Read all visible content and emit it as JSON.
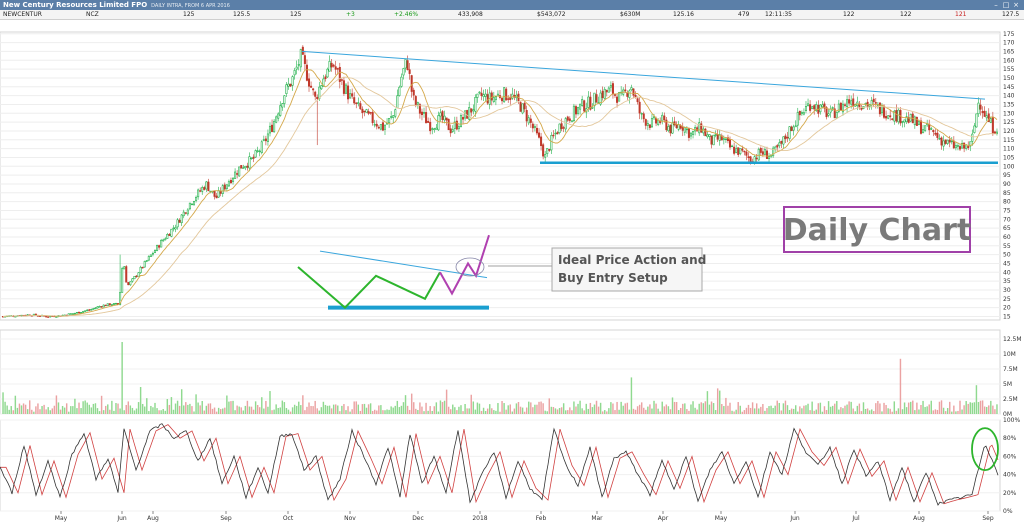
{
  "window": {
    "title": "New Century Resources Limited FPO",
    "subtitle": "DAILY INTRA, FROM 6 APR 2016",
    "buttons": [
      "–",
      "□",
      "×"
    ]
  },
  "quote_bar": {
    "name": "NEWCENTUR",
    "code": "NCZ",
    "bid": "125",
    "ask": "125.5",
    "last": "125",
    "change": "+3",
    "change_pct": "+2.46%",
    "volume": "433,908",
    "value": "$543,072",
    "market_cap": "$630M",
    "vwap": "125.16",
    "trades": "479",
    "time": "12:11:35",
    "open": "122",
    "high": "122",
    "low": "121",
    "close_label": "127.5"
  },
  "colors": {
    "up": "#22b14c",
    "down": "#c0392b",
    "sma_fast": "#d4a84a",
    "sma_slow": "#e3c79b",
    "trendline": "#3aa6dd",
    "support": "#1a9fd0",
    "ideal_up": "#2db52d",
    "ideal_breakout": "#b040b0",
    "label_border": "#a040a8",
    "stoch_k": "#333333",
    "stoch_d": "#d04040",
    "vol_up": "#8fd98f",
    "vol_down": "#eba2a2"
  },
  "annotations": {
    "big_label": "Daily Chart",
    "callout_line1": "Ideal Price Action and",
    "callout_line2": "Buy Entry Setup"
  },
  "chart_data": [
    {
      "type": "candlestick",
      "panel": "price",
      "y_ticks": [
        "175",
        "170",
        "165",
        "160",
        "155",
        "150",
        "145",
        "140",
        "135",
        "130",
        "125",
        "120",
        "115",
        "110",
        "105",
        "100",
        "95",
        "90",
        "85",
        "80",
        "75",
        "70",
        "65",
        "60",
        "55",
        "50",
        "45",
        "40",
        "35",
        "30",
        "25",
        "20",
        "15"
      ],
      "ylim": [
        13,
        176
      ],
      "x_ticks": [
        "May",
        "Jun",
        "Aug",
        "Sep",
        "Oct",
        "Nov",
        "Dec",
        "2018",
        "Feb",
        "Mar",
        "Apr",
        "May",
        "Jun",
        "Jul",
        "Aug",
        "Sep"
      ],
      "x_tick_index": [
        61,
        122,
        153,
        226,
        288,
        350,
        418,
        480,
        541,
        597,
        663,
        721,
        795,
        856,
        919,
        988
      ],
      "n_days": 485,
      "price_path": [
        [
          0,
          15
        ],
        [
          15,
          15.5
        ],
        [
          30,
          16
        ],
        [
          45,
          15
        ],
        [
          60,
          15.5
        ],
        [
          75,
          17
        ],
        [
          90,
          19
        ],
        [
          100,
          21
        ],
        [
          110,
          22
        ],
        [
          118,
          22
        ],
        [
          122,
          48
        ],
        [
          126,
          32
        ],
        [
          132,
          36
        ],
        [
          145,
          46
        ],
        [
          160,
          57
        ],
        [
          175,
          67
        ],
        [
          190,
          80
        ],
        [
          205,
          90
        ],
        [
          215,
          82
        ],
        [
          228,
          92
        ],
        [
          240,
          100
        ],
        [
          252,
          104
        ],
        [
          262,
          112
        ],
        [
          272,
          124
        ],
        [
          282,
          140
        ],
        [
          292,
          150
        ],
        [
          300,
          162
        ],
        [
          306,
          152
        ],
        [
          314,
          138
        ],
        [
          322,
          150
        ],
        [
          332,
          158
        ],
        [
          342,
          146
        ],
        [
          352,
          136
        ],
        [
          362,
          130
        ],
        [
          372,
          126
        ],
        [
          382,
          122
        ],
        [
          392,
          128
        ],
        [
          400,
          150
        ],
        [
          406,
          160
        ],
        [
          412,
          138
        ],
        [
          420,
          130
        ],
        [
          430,
          123
        ],
        [
          440,
          127
        ],
        [
          450,
          121
        ],
        [
          460,
          126
        ],
        [
          470,
          132
        ],
        [
          480,
          140
        ],
        [
          490,
          138
        ],
        [
          500,
          141
        ],
        [
          510,
          140
        ],
        [
          520,
          134
        ],
        [
          530,
          124
        ],
        [
          540,
          112
        ],
        [
          544,
          105
        ],
        [
          550,
          114
        ],
        [
          560,
          124
        ],
        [
          570,
          129
        ],
        [
          580,
          134
        ],
        [
          590,
          136
        ],
        [
          600,
          141
        ],
        [
          610,
          143
        ],
        [
          620,
          138
        ],
        [
          630,
          146
        ],
        [
          640,
          128
        ],
        [
          650,
          124
        ],
        [
          660,
          126
        ],
        [
          670,
          121
        ],
        [
          680,
          124
        ],
        [
          690,
          118
        ],
        [
          700,
          122
        ],
        [
          710,
          114
        ],
        [
          720,
          116
        ],
        [
          730,
          110
        ],
        [
          740,
          108
        ],
        [
          750,
          104
        ],
        [
          760,
          108
        ],
        [
          770,
          106
        ],
        [
          780,
          112
        ],
        [
          790,
          122
        ],
        [
          800,
          130
        ],
        [
          810,
          136
        ],
        [
          820,
          132
        ],
        [
          830,
          129
        ],
        [
          840,
          134
        ],
        [
          850,
          138
        ],
        [
          860,
          136
        ],
        [
          870,
          135
        ],
        [
          880,
          132
        ],
        [
          890,
          130
        ],
        [
          900,
          128
        ],
        [
          910,
          126
        ],
        [
          920,
          122
        ],
        [
          930,
          120
        ],
        [
          940,
          115
        ],
        [
          950,
          112
        ],
        [
          960,
          110
        ],
        [
          970,
          112
        ],
        [
          978,
          138
        ],
        [
          985,
          128
        ],
        [
          992,
          122
        ]
      ],
      "spikes": [
        [
          120,
          50
        ],
        [
          300,
          165
        ],
        [
          316,
          112
        ],
        [
          406,
          159
        ],
        [
          544,
          102
        ],
        [
          978,
          139
        ]
      ],
      "trendline": [
        [
          302,
          165
        ],
        [
          985,
          138
        ]
      ],
      "support_line": [
        [
          540,
          102
        ],
        [
          998,
          102
        ]
      ],
      "ideal_pattern": {
        "uptrend_points": [
          [
            298,
            43
          ],
          [
            345,
            20
          ],
          [
            376,
            38
          ],
          [
            425,
            25
          ],
          [
            440,
            40
          ]
        ],
        "breakout_points": [
          [
            440,
            40
          ],
          [
            452,
            28
          ],
          [
            468,
            45
          ],
          [
            476,
            38
          ],
          [
            489,
            61
          ]
        ],
        "downtrend_line": [
          [
            320,
            52
          ],
          [
            487,
            37
          ]
        ],
        "support_line": [
          [
            328,
            20
          ],
          [
            489,
            20
          ]
        ],
        "circle_center": [
          470,
          43
        ]
      },
      "series": [
        {
          "name": "",
          "kind": "sma_fast"
        },
        {
          "name": "",
          "kind": "sma_slow"
        }
      ]
    },
    {
      "type": "bar",
      "panel": "volume",
      "y_ticks": [
        "12.5M",
        "10M",
        "7.5M",
        "5M",
        "2.5M",
        "0M"
      ],
      "ylim": [
        0,
        14
      ],
      "spikes": [
        [
          122,
          12
        ],
        [
          140,
          4.5
        ],
        [
          260,
          2.8
        ],
        [
          410,
          3.4
        ],
        [
          630,
          6.1
        ],
        [
          900,
          9.2
        ],
        [
          975,
          4.8
        ]
      ],
      "base_level": 1.2
    },
    {
      "type": "line",
      "panel": "stochastic",
      "y_ticks": [
        "100%",
        "80%",
        "60%",
        "40%",
        "20%",
        "0%"
      ],
      "ylim": [
        0,
        100
      ],
      "k_points": [
        [
          0,
          48
        ],
        [
          12,
          20
        ],
        [
          24,
          72
        ],
        [
          36,
          18
        ],
        [
          48,
          55
        ],
        [
          60,
          15
        ],
        [
          72,
          62
        ],
        [
          84,
          86
        ],
        [
          96,
          35
        ],
        [
          108,
          58
        ],
        [
          118,
          20
        ],
        [
          124,
          90
        ],
        [
          136,
          45
        ],
        [
          150,
          88
        ],
        [
          162,
          95
        ],
        [
          174,
          80
        ],
        [
          186,
          88
        ],
        [
          198,
          55
        ],
        [
          210,
          80
        ],
        [
          222,
          30
        ],
        [
          234,
          60
        ],
        [
          246,
          15
        ],
        [
          258,
          48
        ],
        [
          268,
          20
        ],
        [
          280,
          82
        ],
        [
          292,
          85
        ],
        [
          304,
          45
        ],
        [
          316,
          60
        ],
        [
          328,
          12
        ],
        [
          340,
          35
        ],
        [
          352,
          88
        ],
        [
          364,
          60
        ],
        [
          376,
          30
        ],
        [
          388,
          70
        ],
        [
          400,
          15
        ],
        [
          410,
          85
        ],
        [
          422,
          30
        ],
        [
          434,
          60
        ],
        [
          446,
          20
        ],
        [
          458,
          90
        ],
        [
          470,
          10
        ],
        [
          482,
          40
        ],
        [
          494,
          65
        ],
        [
          506,
          15
        ],
        [
          518,
          55
        ],
        [
          530,
          25
        ],
        [
          542,
          12
        ],
        [
          554,
          90
        ],
        [
          566,
          50
        ],
        [
          578,
          28
        ],
        [
          590,
          70
        ],
        [
          602,
          15
        ],
        [
          614,
          58
        ],
        [
          626,
          65
        ],
        [
          638,
          40
        ],
        [
          650,
          18
        ],
        [
          662,
          55
        ],
        [
          674,
          25
        ],
        [
          686,
          60
        ],
        [
          698,
          10
        ],
        [
          710,
          45
        ],
        [
          722,
          65
        ],
        [
          734,
          30
        ],
        [
          746,
          55
        ],
        [
          758,
          15
        ],
        [
          770,
          65
        ],
        [
          782,
          40
        ],
        [
          794,
          90
        ],
        [
          806,
          65
        ],
        [
          818,
          50
        ],
        [
          830,
          70
        ],
        [
          842,
          30
        ],
        [
          854,
          68
        ],
        [
          866,
          38
        ],
        [
          878,
          55
        ],
        [
          890,
          12
        ],
        [
          902,
          48
        ],
        [
          914,
          10
        ],
        [
          926,
          42
        ],
        [
          938,
          8
        ],
        [
          950,
          12
        ],
        [
          962,
          15
        ],
        [
          972,
          18
        ],
        [
          985,
          75
        ],
        [
          998,
          40
        ]
      ],
      "highlight_circle": [
        985,
        68
      ]
    }
  ]
}
